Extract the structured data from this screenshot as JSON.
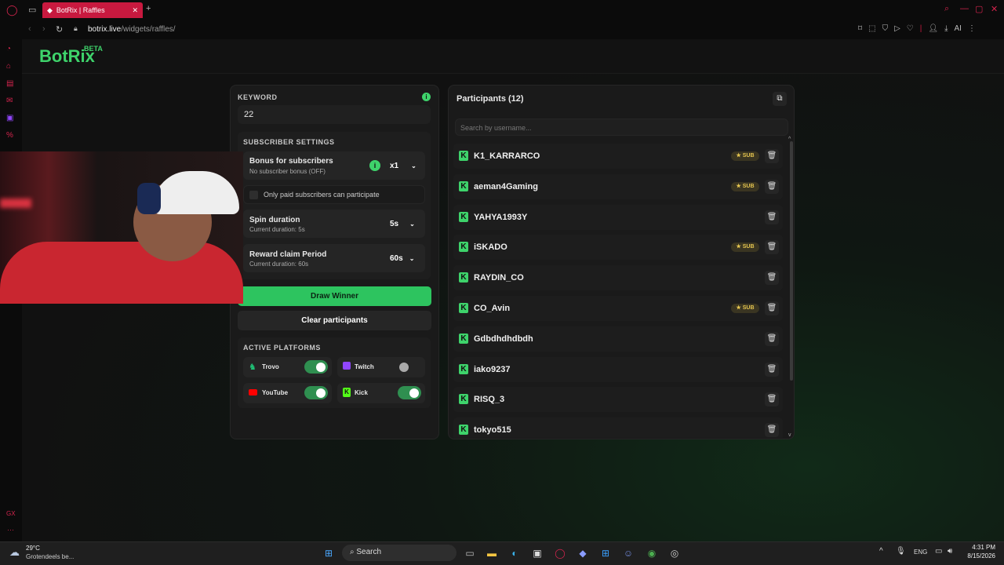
{
  "browser": {
    "tab_title": "BotRix | Raffles",
    "url_host": "botrix.live",
    "url_path": "/widgets/raffles/",
    "ai_label": "AI"
  },
  "app": {
    "logo": "BotRix",
    "beta": "BETA"
  },
  "left": {
    "keyword_label": "KEYWORD",
    "keyword_value": "22",
    "sub_settings_label": "SUBSCRIBER SETTINGS",
    "bonus_title": "Bonus for subscribers",
    "bonus_sub": "No subscriber bonus (OFF)",
    "bonus_value": "x1",
    "paid_only": "Only paid subscribers can participate",
    "spin_title": "Spin duration",
    "spin_sub": "Current duration: 5s",
    "spin_value": "5s",
    "reward_title": "Reward claim Period",
    "reward_sub": "Current duration: 60s",
    "reward_value": "60s",
    "draw_label": "Draw Winner",
    "clear_label": "Clear participants",
    "platforms_label": "ACTIVE PLATFORMS",
    "platforms": [
      {
        "name": "Trovo",
        "enabled": true,
        "color": "#1fbf75"
      },
      {
        "name": "Twitch",
        "enabled": false,
        "color": "#9146ff"
      },
      {
        "name": "YouTube",
        "enabled": true,
        "color": "#ff0000"
      },
      {
        "name": "Kick",
        "enabled": true,
        "color": "#53fc18"
      }
    ]
  },
  "right": {
    "title": "Participants (12)",
    "search_placeholder": "Search by username...",
    "sub_badge": "SUB",
    "participants": [
      {
        "name": "K1_KARRARCO",
        "sub": true
      },
      {
        "name": "aeman4Gaming",
        "sub": true
      },
      {
        "name": "YAHYA1993Y",
        "sub": false
      },
      {
        "name": "iSKADO",
        "sub": true
      },
      {
        "name": "RAYDIN_CO",
        "sub": false
      },
      {
        "name": "CO_Avin",
        "sub": true
      },
      {
        "name": "Gdbdhdhdbdh",
        "sub": false
      },
      {
        "name": "iako9237",
        "sub": false
      },
      {
        "name": "RISQ_3",
        "sub": false
      },
      {
        "name": "tokyo515",
        "sub": false
      }
    ]
  },
  "taskbar": {
    "temp": "29°C",
    "weather": "Grotendeels be...",
    "search": "Search",
    "lang": "ENG",
    "time": "4:31 PM",
    "date": "8/15/2026"
  },
  "colors": {
    "accent": "#3ed36b",
    "brand_red": "#c8193f"
  }
}
